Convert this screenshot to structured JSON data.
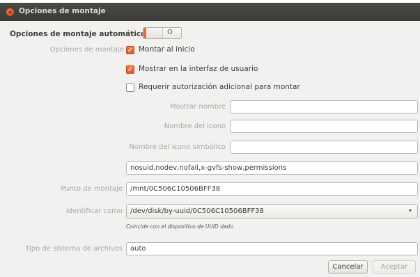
{
  "window": {
    "title": "Opciones de montaje"
  },
  "automatic": {
    "heading": "Opciones de montaje automático",
    "toggle_off_label": "O"
  },
  "mount_options": {
    "label": "Opciones de montaje",
    "checkboxes": [
      {
        "label": "Montar al inicio",
        "checked": true
      },
      {
        "label": "Mostrar en la interfaz de usuario",
        "checked": true
      },
      {
        "label": "Requerir autorización adicional para montar",
        "checked": false
      }
    ],
    "show_name": {
      "label": "Mostrar nombre",
      "value": ""
    },
    "icon_name": {
      "label": "Nombre del icono",
      "value": ""
    },
    "symbolic_icon_name": {
      "label": "Nombre del icono simbólico",
      "value": ""
    },
    "options_value": "nosuid,nodev,nofail,x-gvfs-show,permissions"
  },
  "mount_point": {
    "label": "Punto de montaje",
    "value": "/mnt/0C506C10506BFF38"
  },
  "identify_as": {
    "label": "Identificar como",
    "value": "/dev/disk/by-uuid/0C506C10506BFF38",
    "hint": "Coincide con el dispositivo de UUID dado"
  },
  "filesystem": {
    "label": "Tipo de sistema de archivos",
    "value": "auto"
  },
  "buttons": {
    "cancel": "Cancelar",
    "accept": "Aceptar"
  },
  "colors": {
    "accent": "#e66a3a",
    "titlebar": "#3c3b37"
  },
  "icons": {
    "close": "close-icon",
    "check": "check-icon",
    "dropdown": "chevron-down-icon"
  }
}
